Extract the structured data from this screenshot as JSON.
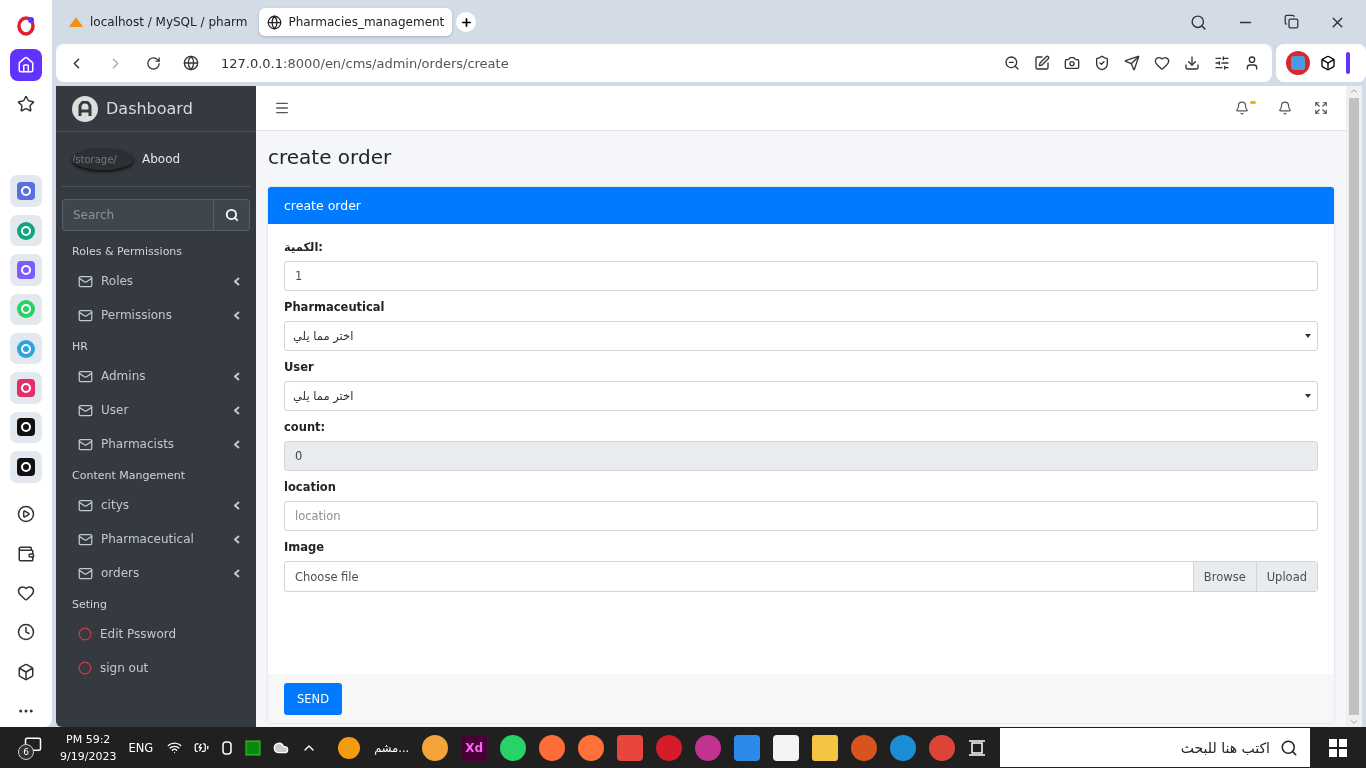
{
  "browser": {
    "tabs": [
      {
        "title": "localhost / MySQL / pharm",
        "selected": false
      },
      {
        "title": "Pharmacies_management",
        "selected": true
      }
    ],
    "url_host": "127.0.0.1",
    "url_rest": ":8000/en/cms/admin/orders/create"
  },
  "sidebar": {
    "brand": "Dashboard",
    "user": {
      "avatar_alt": "/storage/",
      "name": "Abood"
    },
    "search": {
      "placeholder": "Search"
    },
    "sections": [
      {
        "header": "Roles & Permissions",
        "items": [
          {
            "label": "Roles",
            "kind": "menu"
          },
          {
            "label": "Permissions",
            "kind": "menu"
          }
        ]
      },
      {
        "header": "HR",
        "items": [
          {
            "label": "Admins",
            "kind": "menu"
          },
          {
            "label": "User",
            "kind": "menu"
          },
          {
            "label": "Pharmacists",
            "kind": "menu"
          }
        ]
      },
      {
        "header": "Content Mangement",
        "items": [
          {
            "label": "citys",
            "kind": "menu"
          },
          {
            "label": "Pharmaceutical",
            "kind": "menu"
          },
          {
            "label": "orders",
            "kind": "menu"
          }
        ]
      },
      {
        "header": "Seting",
        "items": [
          {
            "label": "Edit Pssword",
            "kind": "action"
          },
          {
            "label": "sign out",
            "kind": "action"
          }
        ]
      }
    ]
  },
  "page": {
    "title": "create order",
    "card_title": "create order",
    "fields": [
      {
        "kind": "text",
        "label": "الكمية:",
        "value": "1",
        "disabled": false
      },
      {
        "kind": "select",
        "label": "Pharmaceutical",
        "value": "اختر مما يلي"
      },
      {
        "kind": "select",
        "label": "User",
        "value": "اختر مما يلي"
      },
      {
        "kind": "text",
        "label": "count:",
        "value": "0",
        "disabled": true
      },
      {
        "kind": "text",
        "label": "location",
        "placeholder": "location",
        "disabled": false
      },
      {
        "kind": "file",
        "label": "Image",
        "placeholder": "Choose file",
        "buttons": [
          "Browse",
          "Upload"
        ]
      }
    ],
    "submit": "SEND"
  },
  "taskbar": {
    "notifications": "6",
    "time": "PM 59:2",
    "date": "9/19/2023",
    "language": "ENG",
    "running_app": "مشم...",
    "xd_label": "Xd",
    "search_placeholder": "اكتب هنا للبحث"
  }
}
